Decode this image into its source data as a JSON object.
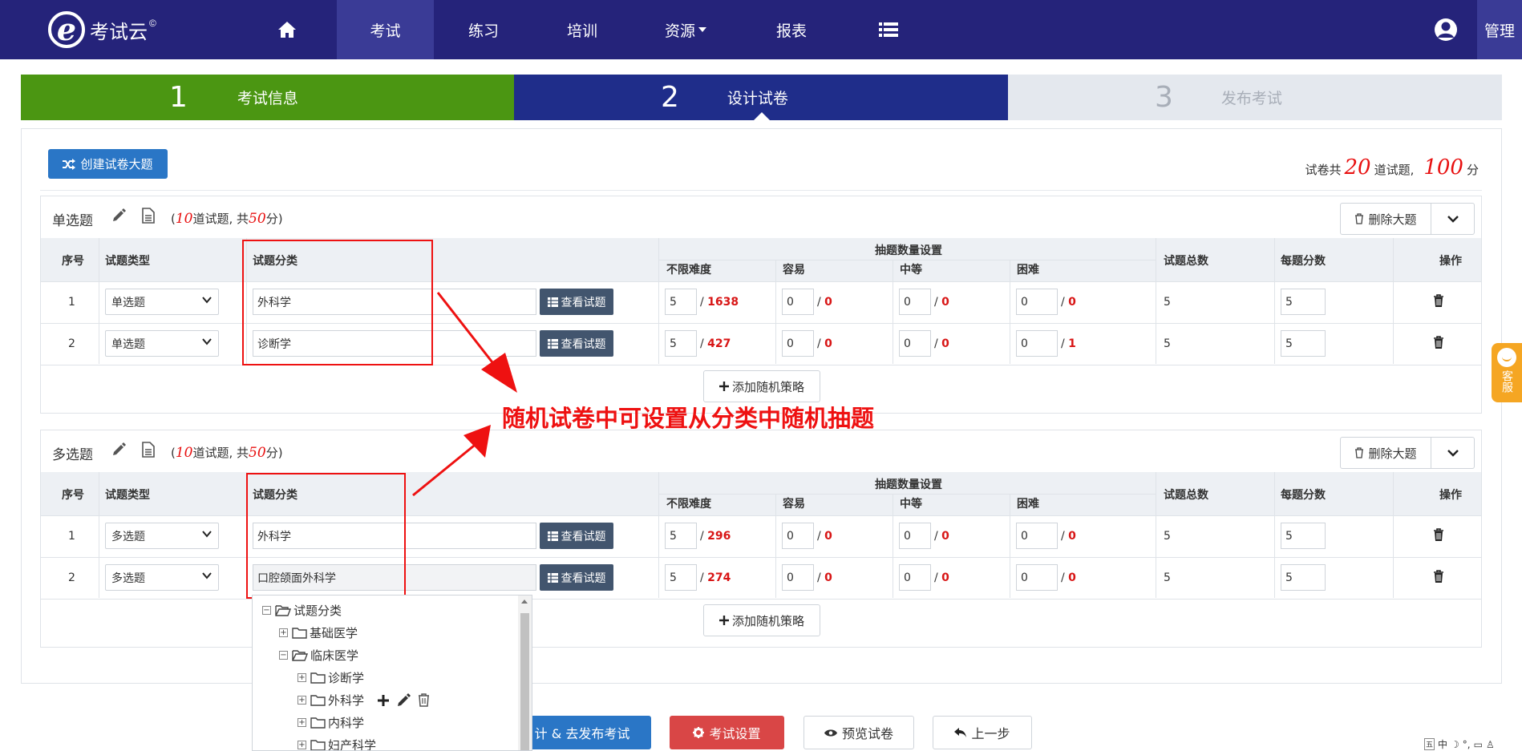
{
  "nav": {
    "logo_text": "考试云",
    "logo_copyright": "©",
    "items": [
      {
        "label": "",
        "icon": "home-icon"
      },
      {
        "label": "考试"
      },
      {
        "label": "练习"
      },
      {
        "label": "培训"
      },
      {
        "label": "资源"
      },
      {
        "label": "报表"
      },
      {
        "label": "",
        "icon": "list-icon"
      }
    ],
    "admin_label": "管理"
  },
  "steps": [
    {
      "num": "1",
      "label": "考试信息"
    },
    {
      "num": "2",
      "label": "设计试卷"
    },
    {
      "num": "3",
      "label": "发布考试"
    }
  ],
  "create_button": "创建试卷大题",
  "summary": {
    "prefix": "试卷共",
    "questions": "20",
    "mid": "道试题,",
    "score": "100",
    "suffix": "分"
  },
  "headers": {
    "index": "序号",
    "type": "试题类型",
    "category": "试题分类",
    "draw_settings": "抽题数量设置",
    "unlimited": "不限难度",
    "easy": "容易",
    "medium": "中等",
    "hard": "困难",
    "total": "试题总数",
    "score_each": "每题分数",
    "ops": "操作"
  },
  "view_button": "查看试题",
  "delete_section_button": "删除大题",
  "add_strategy_button": "添加随机策略",
  "sections": [
    {
      "title": "单选题",
      "count_open": "(",
      "count_num": "10",
      "count_mid": "道试题, 共",
      "count_score": "50",
      "count_close": "分)",
      "rows": [
        {
          "index": "1",
          "type": "单选题",
          "category": "外科学",
          "unlimited": "5",
          "unlimited_total": "1638",
          "easy": "0",
          "easy_total": "0",
          "medium": "0",
          "medium_total": "0",
          "hard": "0",
          "hard_total": "0",
          "total": "5",
          "score": "5"
        },
        {
          "index": "2",
          "type": "单选题",
          "category": "诊断学",
          "unlimited": "5",
          "unlimited_total": "427",
          "easy": "0",
          "easy_total": "0",
          "medium": "0",
          "medium_total": "0",
          "hard": "0",
          "hard_total": "1",
          "total": "5",
          "score": "5"
        }
      ]
    },
    {
      "title": "多选题",
      "count_open": "(",
      "count_num": "10",
      "count_mid": "道试题, 共",
      "count_score": "50",
      "count_close": "分)",
      "rows": [
        {
          "index": "1",
          "type": "多选题",
          "category": "外科学",
          "unlimited": "5",
          "unlimited_total": "296",
          "easy": "0",
          "easy_total": "0",
          "medium": "0",
          "medium_total": "0",
          "hard": "0",
          "hard_total": "0",
          "total": "5",
          "score": "5"
        },
        {
          "index": "2",
          "type": "多选题",
          "category": "口腔颌面外科学",
          "unlimited": "5",
          "unlimited_total": "274",
          "easy": "0",
          "easy_total": "0",
          "medium": "0",
          "medium_total": "0",
          "hard": "0",
          "hard_total": "0",
          "total": "5",
          "score": "5"
        }
      ]
    }
  ],
  "annotation": "随机试卷中可设置从分类中随机抽题",
  "tree": [
    {
      "label": "试题分类",
      "level": 0,
      "toggle": "−",
      "open": true
    },
    {
      "label": "基础医学",
      "level": 1,
      "toggle": "+",
      "open": false
    },
    {
      "label": "临床医学",
      "level": 1,
      "toggle": "−",
      "open": true
    },
    {
      "label": "诊断学",
      "level": 2,
      "toggle": "+",
      "open": false
    },
    {
      "label": "外科学",
      "level": 2,
      "toggle": "+",
      "open": false,
      "actions": true
    },
    {
      "label": "内科学",
      "level": 2,
      "toggle": "+",
      "open": false
    },
    {
      "label": "妇产科学",
      "level": 2,
      "toggle": "+",
      "open": false
    }
  ],
  "bottom": {
    "save_publish": "计 & 去发布考试",
    "exam_settings": "考试设置",
    "preview": "预览试卷",
    "prev_step": "上一步"
  },
  "service_label": "客服",
  "ime_text": "中",
  "colors": {
    "nav": "#25237a",
    "step_done": "#4b9612",
    "step_active": "#1f2d8a",
    "accent_red": "#e81010",
    "primary": "#2a76c6"
  }
}
